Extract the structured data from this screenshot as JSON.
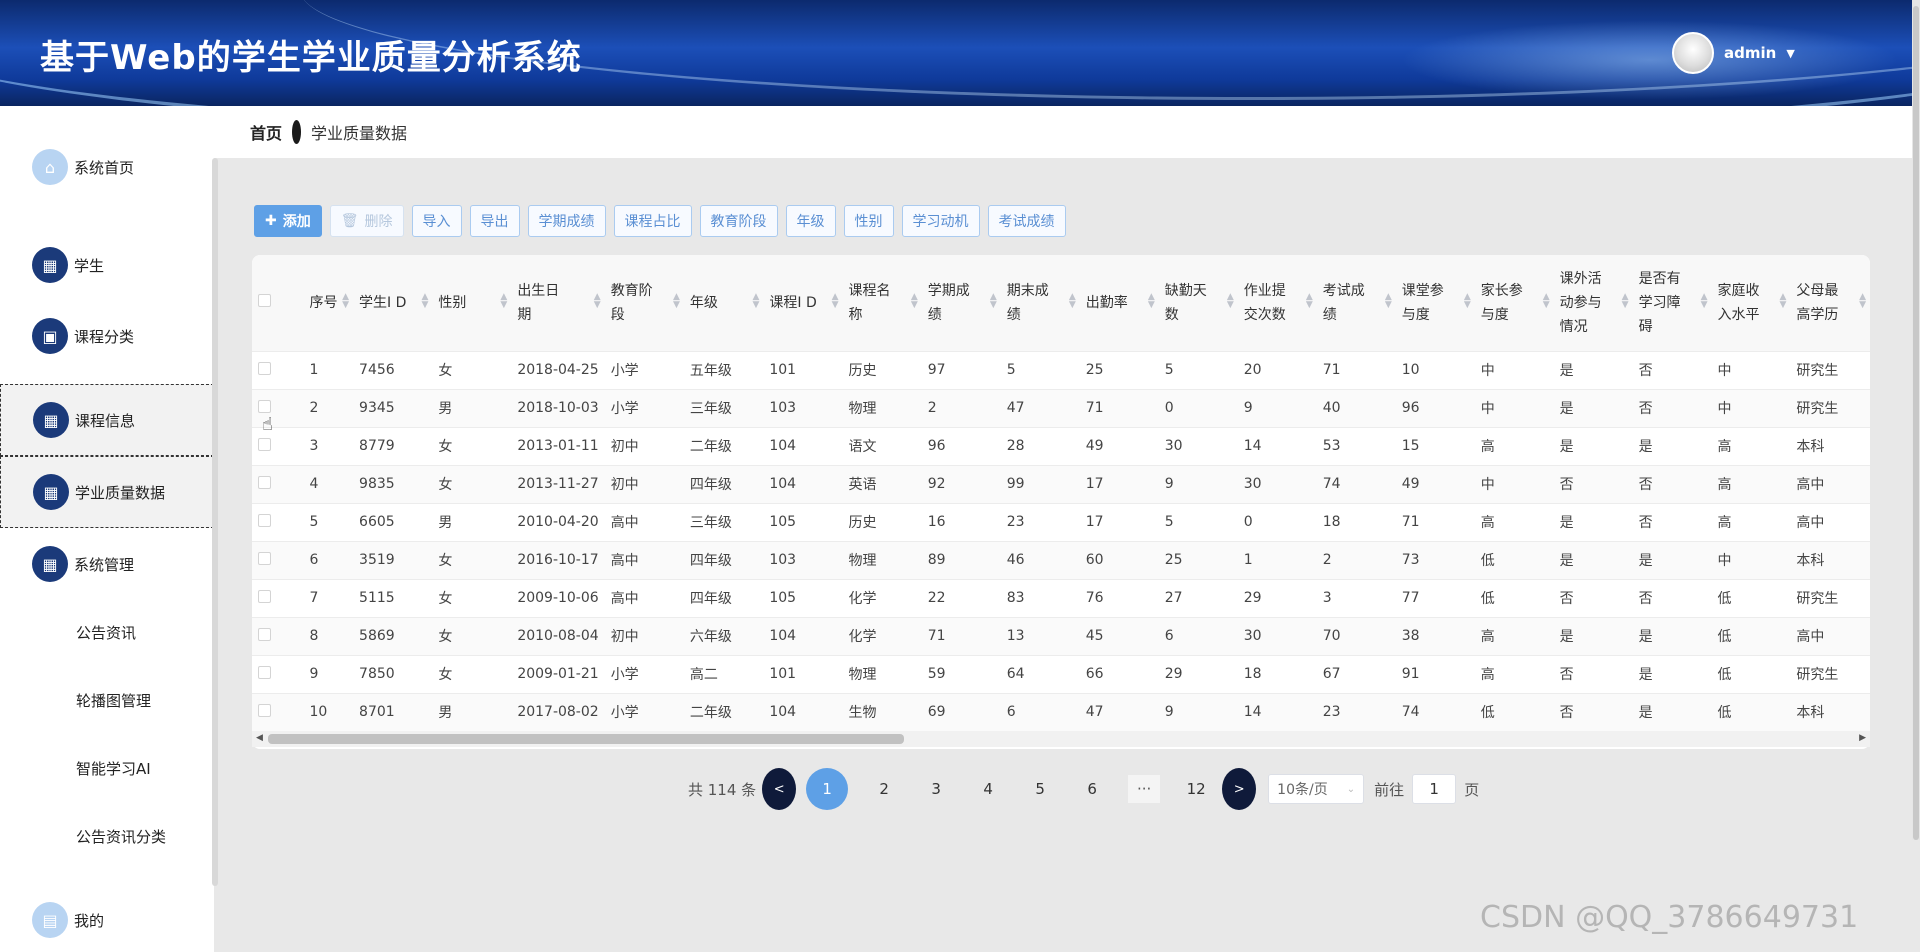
{
  "app": {
    "title": "基于Web的学生学业质量分析系统",
    "user": "admin"
  },
  "breadcrumb": {
    "home": "首页",
    "current": "学业质量数据"
  },
  "sidebar": {
    "items": [
      {
        "label": "系统首页",
        "icon": "home-icon"
      },
      {
        "label": "学生",
        "icon": "grid-icon"
      },
      {
        "label": "课程分类",
        "icon": "briefcase-icon"
      },
      {
        "label": "课程信息",
        "icon": "grid-icon"
      },
      {
        "label": "学业质量数据",
        "icon": "grid-icon"
      },
      {
        "label": "系统管理",
        "icon": "grid-icon"
      }
    ],
    "subitems": [
      "公告资讯",
      "轮播图管理",
      "智能学习AI",
      "公告资讯分类"
    ],
    "me": "我的"
  },
  "toolbar": {
    "add": "添加",
    "delete": "删除",
    "import": "导入",
    "export": "导出",
    "b1": "学期成绩",
    "b2": "课程占比",
    "b3": "教育阶段",
    "b4": "年级",
    "b5": "性别",
    "b6": "学习动机",
    "b7": "考试成绩"
  },
  "table": {
    "headers": [
      "序号",
      "学生I D",
      "性别",
      "出生日期",
      "教育阶段",
      "年级",
      "课程I D",
      "课程名称",
      "学期成绩",
      "期末成绩",
      "出勤率",
      "缺勤天数",
      "作业提交次数",
      "考试成绩",
      "课堂参与度",
      "家长参与度",
      "课外活动参与情况",
      "是否有学习障碍",
      "家庭收入水平",
      "父母最高学历"
    ],
    "rows": [
      [
        "1",
        "7456",
        "女",
        "2018-04-25",
        "小学",
        "五年级",
        "101",
        "历史",
        "97",
        "5",
        "25",
        "5",
        "20",
        "71",
        "10",
        "中",
        "是",
        "否",
        "中",
        "研究生"
      ],
      [
        "2",
        "9345",
        "男",
        "2018-10-03",
        "小学",
        "三年级",
        "103",
        "物理",
        "2",
        "47",
        "71",
        "0",
        "9",
        "40",
        "96",
        "中",
        "是",
        "否",
        "中",
        "研究生"
      ],
      [
        "3",
        "8779",
        "女",
        "2013-01-11",
        "初中",
        "二年级",
        "104",
        "语文",
        "96",
        "28",
        "49",
        "30",
        "14",
        "53",
        "15",
        "高",
        "是",
        "是",
        "高",
        "本科"
      ],
      [
        "4",
        "9835",
        "女",
        "2013-11-27",
        "初中",
        "四年级",
        "104",
        "英语",
        "92",
        "99",
        "17",
        "9",
        "30",
        "74",
        "49",
        "中",
        "否",
        "否",
        "高",
        "高中"
      ],
      [
        "5",
        "6605",
        "男",
        "2010-04-20",
        "高中",
        "三年级",
        "105",
        "历史",
        "16",
        "23",
        "17",
        "5",
        "0",
        "18",
        "71",
        "高",
        "是",
        "否",
        "高",
        "高中"
      ],
      [
        "6",
        "3519",
        "女",
        "2016-10-17",
        "高中",
        "四年级",
        "103",
        "物理",
        "89",
        "46",
        "60",
        "25",
        "1",
        "2",
        "73",
        "低",
        "是",
        "是",
        "中",
        "本科"
      ],
      [
        "7",
        "5115",
        "女",
        "2009-10-06",
        "高中",
        "四年级",
        "105",
        "化学",
        "22",
        "83",
        "76",
        "27",
        "29",
        "3",
        "77",
        "低",
        "否",
        "否",
        "低",
        "研究生"
      ],
      [
        "8",
        "5869",
        "女",
        "2010-08-04",
        "初中",
        "六年级",
        "104",
        "化学",
        "71",
        "13",
        "45",
        "6",
        "30",
        "70",
        "38",
        "高",
        "是",
        "是",
        "低",
        "高中"
      ],
      [
        "9",
        "7850",
        "女",
        "2009-01-21",
        "小学",
        "高二",
        "101",
        "物理",
        "59",
        "64",
        "66",
        "29",
        "18",
        "67",
        "91",
        "高",
        "否",
        "是",
        "低",
        "研究生"
      ],
      [
        "10",
        "8701",
        "男",
        "2017-08-02",
        "小学",
        "二年级",
        "104",
        "生物",
        "69",
        "6",
        "47",
        "9",
        "14",
        "23",
        "74",
        "低",
        "否",
        "是",
        "低",
        "本科"
      ]
    ]
  },
  "pager": {
    "total": "共 114 条",
    "prev": "<",
    "next": ">",
    "pages": [
      "1",
      "2",
      "3",
      "4",
      "5",
      "6"
    ],
    "more": "···",
    "last": "12",
    "size": "10条/页",
    "goto": "前往",
    "page_input": "1",
    "page_unit": "页"
  },
  "watermark": "CSDN @QQ_3786649731"
}
